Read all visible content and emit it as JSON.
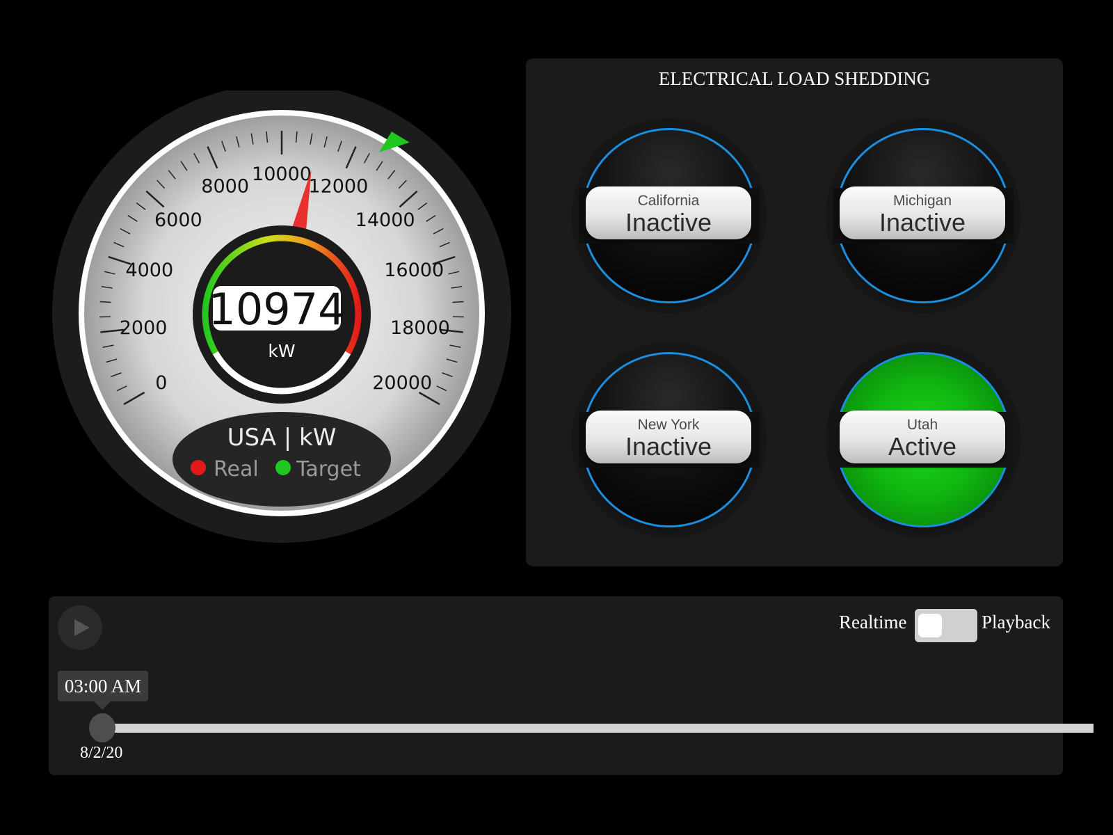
{
  "gauge": {
    "value": 10974,
    "min": 0,
    "max": 20000,
    "target": 12600,
    "reading": "10974",
    "unit": "kW",
    "ticks": [
      "0",
      "2000",
      "4000",
      "6000",
      "8000",
      "10000",
      "12000",
      "14000",
      "16000",
      "18000",
      "20000"
    ],
    "caption": "USA | kW",
    "legend_real": "Real",
    "legend_target": "Target",
    "colors": {
      "real": "#e31a1a",
      "target": "#1ec81e"
    }
  },
  "panel": {
    "title": "ELECTRICAL LOAD SHEDDING",
    "lights": [
      {
        "region": "California",
        "status": "Inactive",
        "active": false
      },
      {
        "region": "Michigan",
        "status": "Inactive",
        "active": false
      },
      {
        "region": "New York",
        "status": "Inactive",
        "active": false
      },
      {
        "region": "Utah",
        "status": "Active",
        "active": true
      }
    ]
  },
  "controls": {
    "mode_left": "Realtime",
    "mode_right": "Playback",
    "time": "03:00 AM",
    "date": "8/2/20",
    "slider_position": 0
  }
}
